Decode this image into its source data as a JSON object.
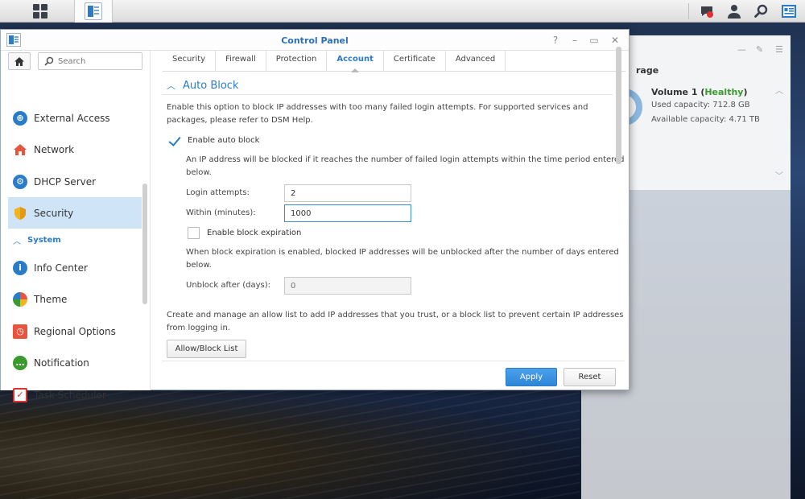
{
  "colors": {
    "accent": "#2a7cc7",
    "healthy": "#3a9a2e",
    "active_bg": "#cfe4f7"
  },
  "window": {
    "title": "Control Panel",
    "help": "?",
    "minimize": "–",
    "maximize": "▭",
    "close": "✕"
  },
  "taskbar": {
    "main_menu_icon": "grid-icon",
    "right_icons": [
      "chat-icon",
      "user-icon",
      "search-icon",
      "widgets-icon"
    ]
  },
  "search": {
    "placeholder": "Search"
  },
  "sidebar": {
    "items": [
      {
        "label": "External Access",
        "icon": "globe-icon"
      },
      {
        "label": "Network",
        "icon": "house-icon"
      },
      {
        "label": "DHCP Server",
        "icon": "dhcp-icon"
      },
      {
        "label": "Security",
        "icon": "shield-icon"
      },
      {
        "label": "Info Center",
        "icon": "info-icon"
      },
      {
        "label": "Theme",
        "icon": "palette-icon"
      },
      {
        "label": "Regional Options",
        "icon": "calendar-clock-icon"
      },
      {
        "label": "Notification",
        "icon": "chat-bubble-icon"
      },
      {
        "label": "Task Scheduler",
        "icon": "calendar-check-icon"
      }
    ],
    "section_system": "System"
  },
  "tabs": [
    "Security",
    "Firewall",
    "Protection",
    "Account",
    "Certificate",
    "Advanced"
  ],
  "active_tab": "Account",
  "auto_block": {
    "heading": "Auto Block",
    "intro_line1": "Enable this option to block IP addresses with too many failed login attempts. For supported services and",
    "intro_line2": "packages, please refer to DSM Help.",
    "enable_label": "Enable auto block",
    "enable_checked": true,
    "rule_line1": "An IP address will be blocked if it reaches the number of failed login attempts within the time period entered",
    "rule_line2": "below.",
    "login_attempts_label": "Login attempts:",
    "login_attempts_value": "2",
    "within_label": "Within (minutes):",
    "within_value": "1000",
    "expiration_label": "Enable block expiration",
    "expiration_checked": false,
    "expiration_line1": "When block expiration is enabled, blocked IP addresses will be unblocked after the number of days entered",
    "expiration_line2": "below.",
    "unblock_label": "Unblock after (days):",
    "unblock_placeholder": "0",
    "list_line1": "Create and manage an allow list to add IP addresses that you trust, or a block list to prevent certain IP addresses",
    "list_line2": "from logging in.",
    "list_button": "Allow/Block List"
  },
  "footer": {
    "apply": "Apply",
    "reset": "Reset"
  },
  "storage_widget": {
    "title": "rage",
    "volume_name": "Volume 1",
    "volume_status": "Healthy",
    "used_label": "Used capacity: 712.8 GB",
    "available_label": "Available capacity: 4.71 TB"
  }
}
